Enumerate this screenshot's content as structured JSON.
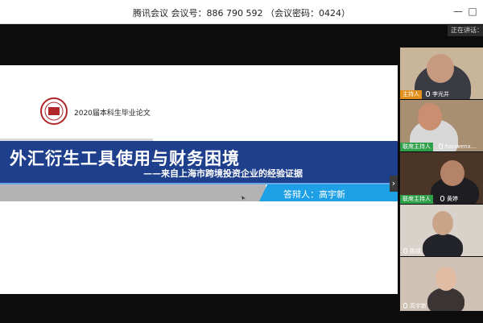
{
  "window": {
    "title": "腾讯会议 会议号：886 790 592 （会议密码：0424）",
    "minimize_glyph": "—",
    "maximize_glyph": "□"
  },
  "speaking_indicator": "正在讲话：高宇新",
  "slide": {
    "logo_text": "湖北大学",
    "caption": "2020届本科生毕业论文",
    "title": "外汇衍生工具使用与财务困境",
    "subtitle": "——来自上海市跨境投资企业的经验证据",
    "presenter": "答辩人：高宇新",
    "next_glyph": "›"
  },
  "participants": [
    {
      "role": "主持人",
      "name": "李光并"
    },
    {
      "role": "联席主持人",
      "name": "houwenx..."
    },
    {
      "role": "联席主持人",
      "name": "黄婷"
    },
    {
      "role": "",
      "name": "陈成"
    },
    {
      "role": "",
      "name": "高宇新"
    }
  ]
}
